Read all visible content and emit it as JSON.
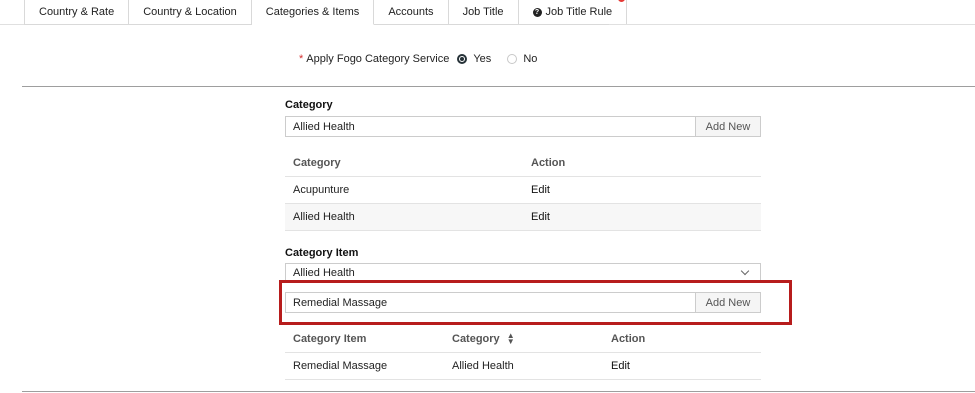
{
  "tabs": [
    {
      "label": "Country & Rate"
    },
    {
      "label": "Country & Location"
    },
    {
      "label": "Categories & Items"
    },
    {
      "label": "Accounts"
    },
    {
      "label": "Job Title"
    },
    {
      "label": "Job Title Rule"
    }
  ],
  "apply_service": {
    "label": "Apply Fogo Category Service",
    "required_mark": "*",
    "yes": "Yes",
    "no": "No",
    "selected": "Yes"
  },
  "category": {
    "section_label": "Category",
    "input_value": "Allied Health",
    "add_button": "Add New",
    "table": {
      "headers": [
        "Category",
        "Action"
      ],
      "rows": [
        {
          "name": "Acupunture",
          "action": "Edit"
        },
        {
          "name": "Allied Health",
          "action": "Edit"
        }
      ]
    }
  },
  "category_item": {
    "section_label": "Category Item",
    "select_value": "Allied Health",
    "input_value": "Remedial Massage",
    "add_button": "Add New",
    "table": {
      "headers": [
        "Category Item",
        "Category",
        "Action"
      ],
      "rows": [
        {
          "item": "Remedial Massage",
          "category": "Allied Health",
          "action": "Edit"
        }
      ]
    }
  },
  "colors": {
    "highlight": "#b71c1c",
    "notification_dot": "#e53935"
  }
}
